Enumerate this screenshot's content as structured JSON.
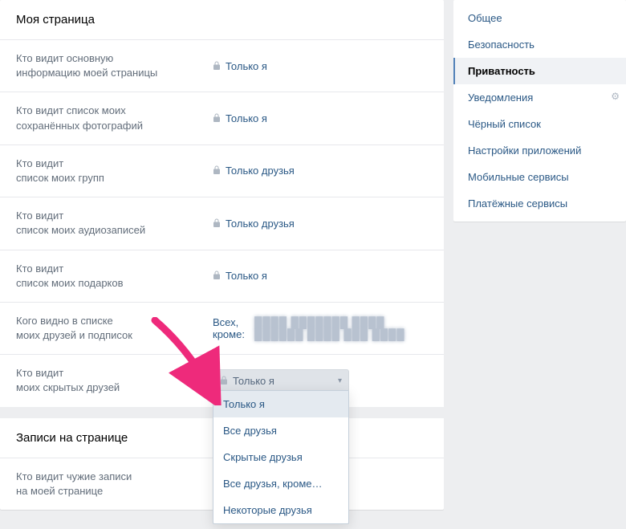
{
  "section1_title": "Моя страница",
  "section2_title": "Записи на странице",
  "rows": [
    {
      "l1": "Кто видит основную",
      "l2": "информацию ",
      "lb": "моей страницы",
      "val": "Только я",
      "lock": true
    },
    {
      "l1": "Кто видит список моих",
      "l2": "",
      "lb": "сохранённых фотографий",
      "val": "Только я",
      "lock": true
    },
    {
      "l1": "Кто видит",
      "l2": "список моих ",
      "lb": "групп",
      "val": "Только друзья",
      "lock": true
    },
    {
      "l1": "Кто видит",
      "l2": "список моих ",
      "lb": "аудиозаписей",
      "val": "Только друзья",
      "lock": true
    },
    {
      "l1": "Кто видит",
      "l2": "список моих ",
      "lb": "подарков",
      "val": "Только я",
      "lock": true
    },
    {
      "l1": "Кого видно в списке",
      "l2": "моих ",
      "lb": "друзей и подписок",
      "val": "Всех, кроме: ",
      "lock": false,
      "blur": true
    },
    {
      "l1": "Кто видит",
      "l2": "моих ",
      "lb": "скрытых друзей",
      "val": "Только я",
      "lock": true,
      "dropdown": true
    }
  ],
  "row8": {
    "l1": "Кто видит ",
    "lb": "чужие записи",
    "l2": "на моей странице"
  },
  "dd": [
    "Только я",
    "Все друзья",
    "Скрытые друзья",
    "Все друзья, кроме…",
    "Некоторые друзья"
  ],
  "side": [
    "Общее",
    "Безопасность",
    "Приватность",
    "Уведомления",
    "Чёрный список",
    "Настройки приложений",
    "Мобильные сервисы",
    "Платёжные сервисы"
  ],
  "side_active": 2,
  "side_gear": 3
}
